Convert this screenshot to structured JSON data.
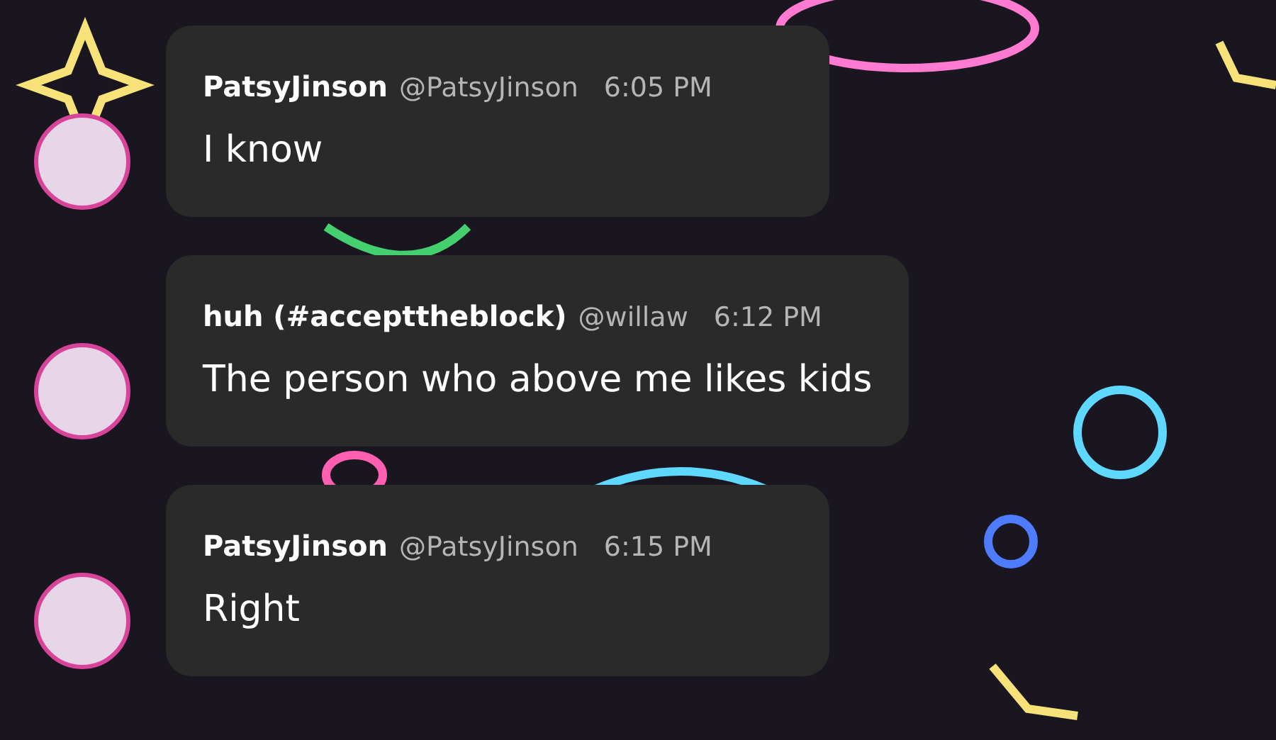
{
  "messages": [
    {
      "display_name": "PatsyJinson",
      "handle": "@PatsyJinson",
      "time": "6:05 PM",
      "text": "I know"
    },
    {
      "display_name": "huh (#accepttheblock)",
      "handle": "@willaw",
      "time": "6:12 PM",
      "text": "The person who above me likes kids"
    },
    {
      "display_name": "PatsyJinson",
      "handle": "@PatsyJinson",
      "time": "6:15 PM",
      "text": "Right"
    }
  ]
}
